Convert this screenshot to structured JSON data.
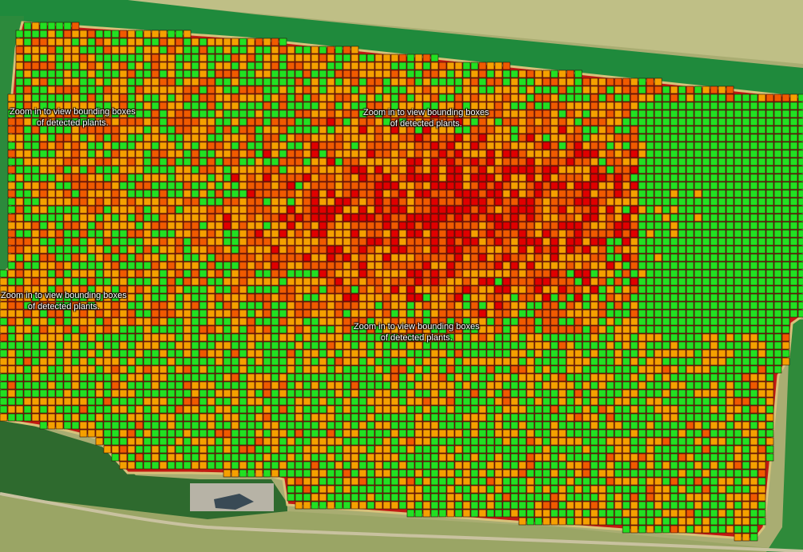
{
  "map": {
    "labels": [
      {
        "line1": "Zoom in to view bounding boxes",
        "line2": "of detected plants."
      },
      {
        "line1": "Zoom in to view bounding boxes",
        "line2": "of detected plants."
      },
      {
        "line1": "Zoom in to view bounding boxes",
        "line2": "of detected plants."
      },
      {
        "line1": "Zoom in to view bounding boxes",
        "line2": "of detected plants."
      }
    ],
    "legend_colors": {
      "very_low": "#e00000",
      "low": "#f05a00",
      "medium": "#f5a000",
      "high": "#22e022"
    },
    "surroundings": {
      "field_color": "#b9b97c",
      "grass_color": "#2f8a3a",
      "tree_color": "#2e6a2e",
      "boundary_color": "#d8c27a"
    }
  }
}
